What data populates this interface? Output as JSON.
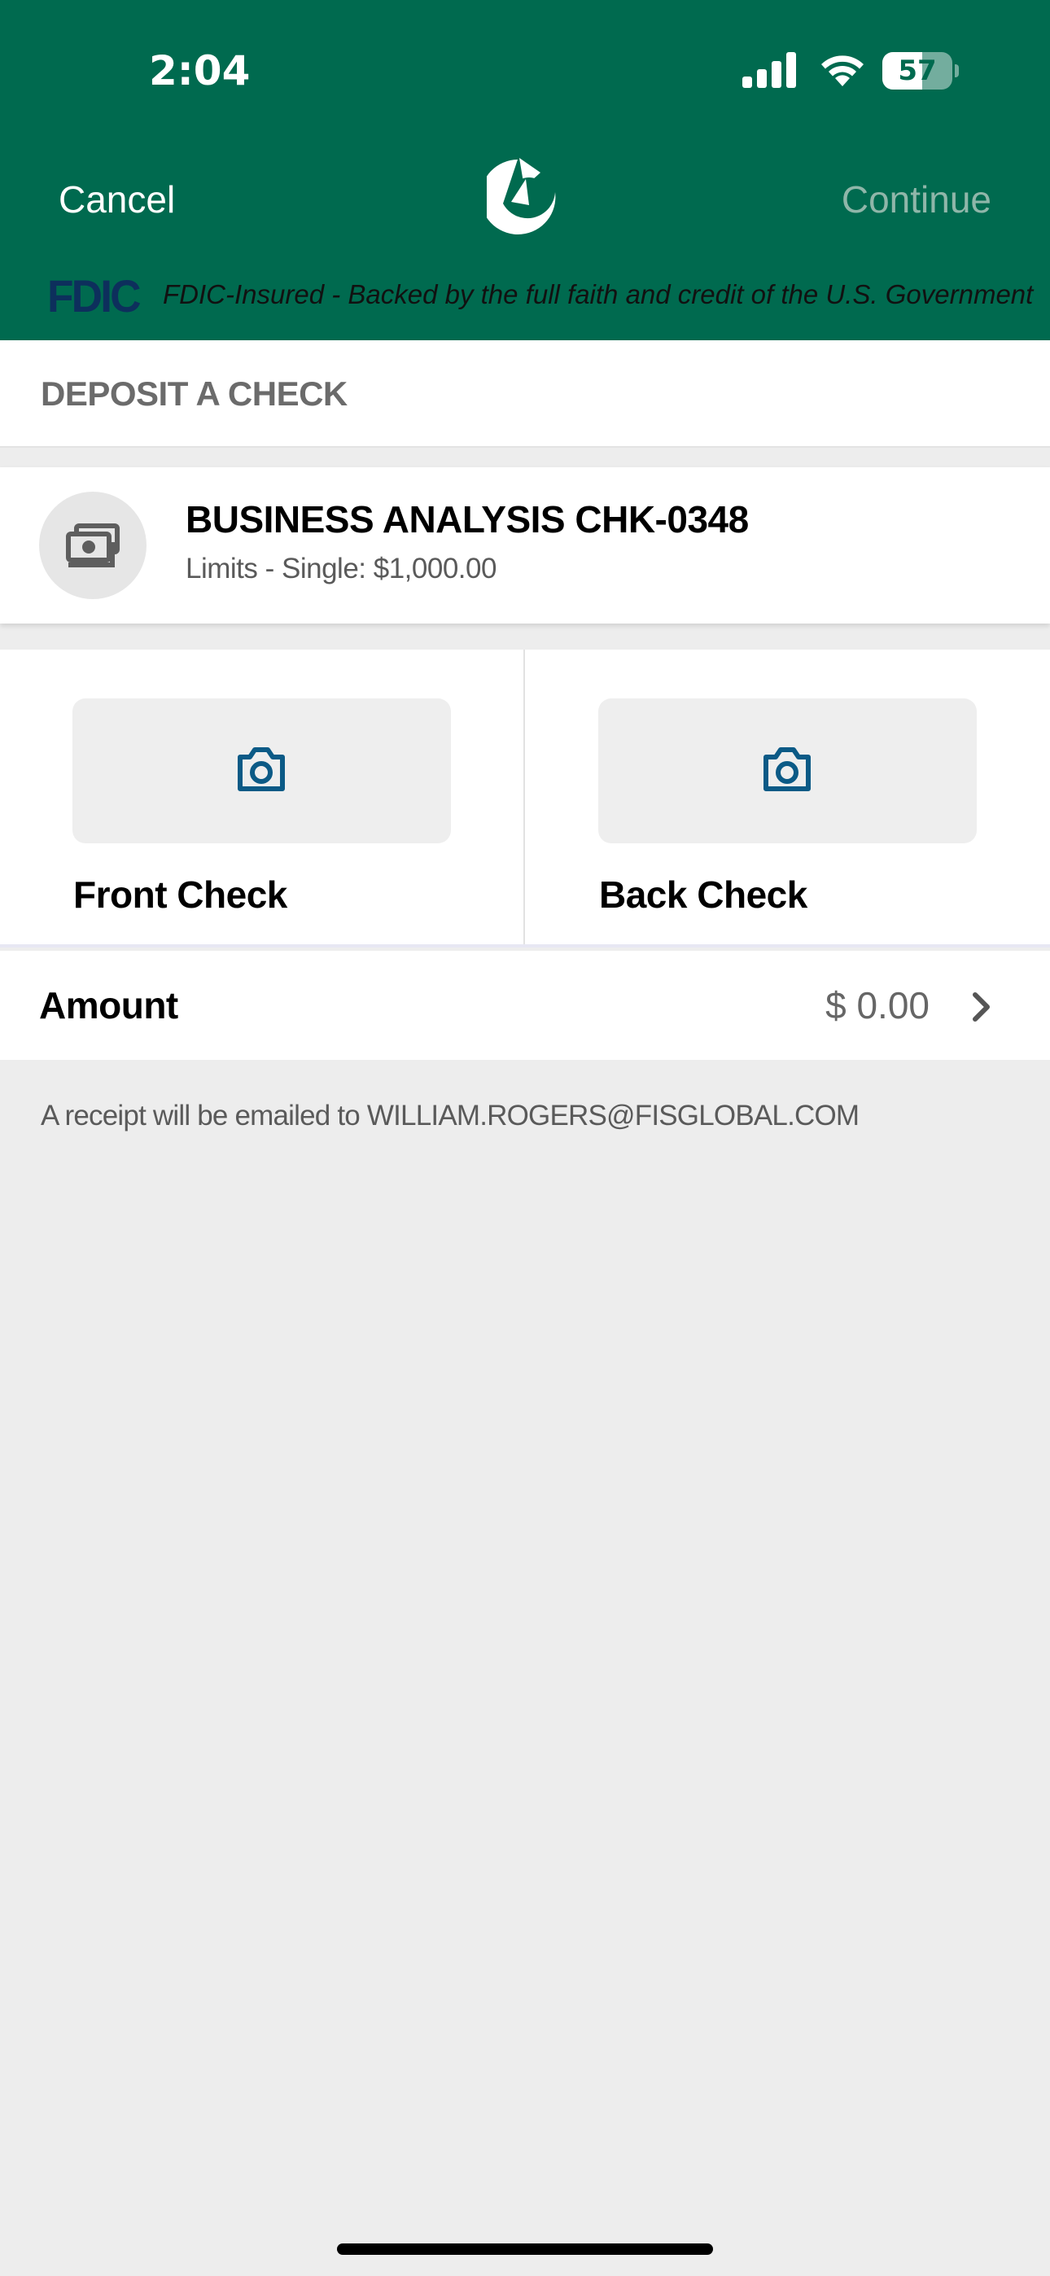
{
  "status_bar": {
    "time": "2:04",
    "battery_level": "57",
    "battery_fraction": 0.57
  },
  "nav": {
    "cancel_label": "Cancel",
    "continue_label": "Continue",
    "logo_icon": "bank-swirl-logo"
  },
  "fdic": {
    "logo": "FDIC",
    "text": "FDIC-Insured - Backed by the full faith and credit of the U.S. Government"
  },
  "section": {
    "title": "DEPOSIT A CHECK"
  },
  "account": {
    "icon": "money-stack-icon",
    "name": "BUSINESS ANALYSIS CHK-0348",
    "limits": "Limits - Single: $1,000.00"
  },
  "checks": {
    "front_label": "Front Check",
    "back_label": "Back Check",
    "icon": "camera-icon"
  },
  "amount": {
    "label": "Amount",
    "value": "$ 0.00"
  },
  "receipt": {
    "text": "A receipt will be emailed to WILLIAM.ROGERS@FISGLOBAL.COM"
  },
  "colors": {
    "header_green": "#006a4f",
    "continue_disabled": "#8fb6a9",
    "icon_blue": "#0b5a86",
    "fdic_navy": "#0d2f5c"
  }
}
